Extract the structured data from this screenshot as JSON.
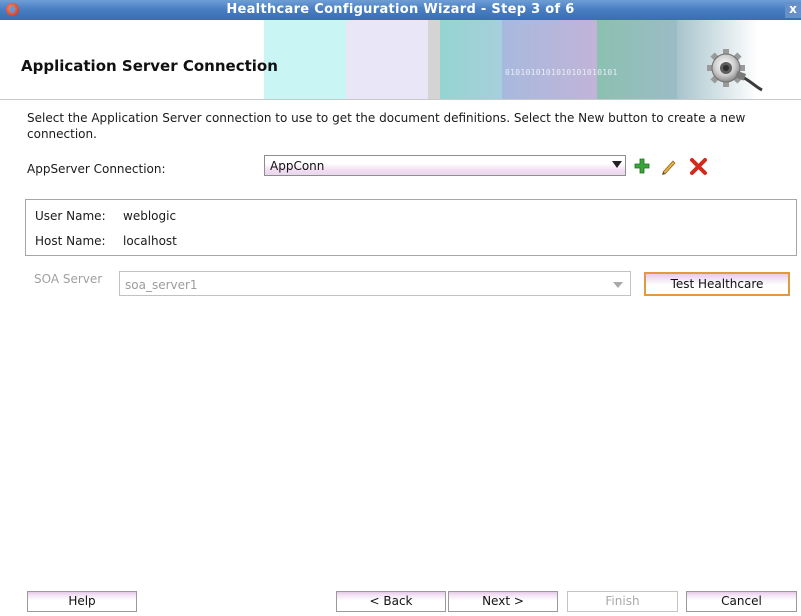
{
  "window": {
    "title": "Healthcare Configuration Wizard - Step 3 of 6",
    "close_label": "x"
  },
  "banner": {
    "title": "Application Server Connection",
    "binary_text": "0101010101010101010101"
  },
  "content": {
    "intro_text": "Select the Application Server connection to use to get the document definitions.  Select the New button to create a new connection.",
    "appserver": {
      "label": "AppServer Connection:",
      "value": "AppConn"
    },
    "connection_info": {
      "user_name_label": "User Name:",
      "user_name_value": "weblogic",
      "host_name_label": "Host Name:",
      "host_name_value": "localhost"
    },
    "soa_server": {
      "label": "SOA Server",
      "value": "soa_server1"
    },
    "test_button": "Test Healthcare"
  },
  "footer": {
    "help": "Help",
    "back": "< Back",
    "next": "Next >",
    "finish": "Finish",
    "cancel": "Cancel"
  },
  "colors": {
    "title_bar": "#4a7fc3",
    "focus_border": "#e39a3d",
    "add_icon": "#2f9a2f",
    "delete_icon": "#d22a1e"
  }
}
